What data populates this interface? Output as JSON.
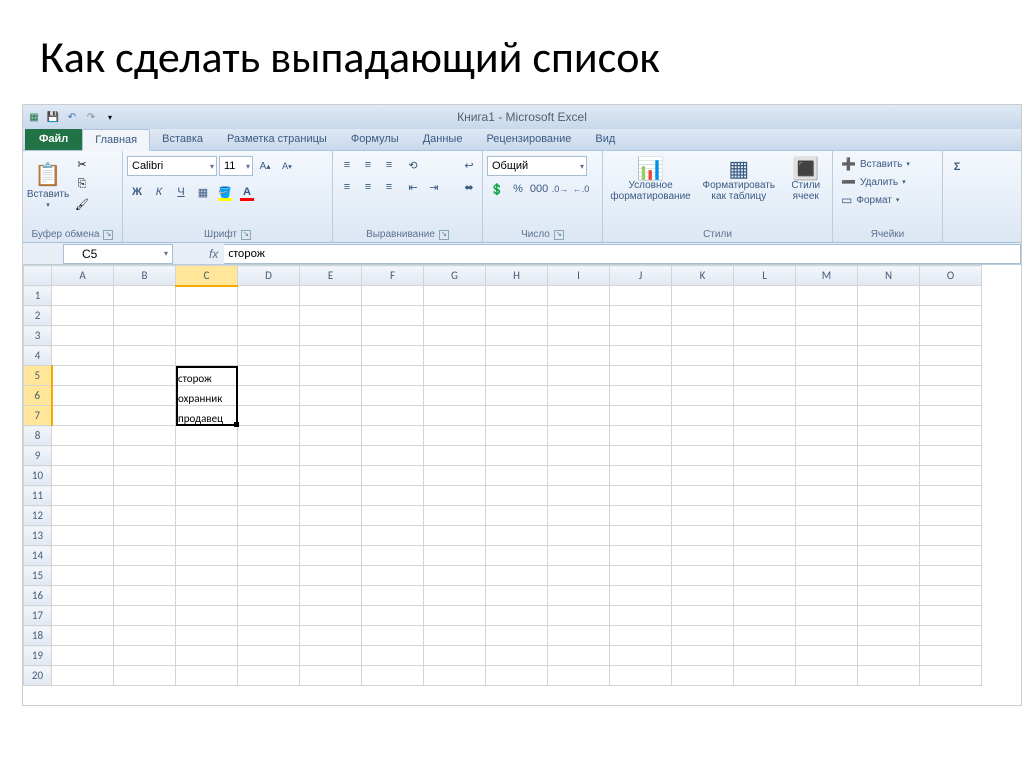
{
  "slide": {
    "title": "Как сделать выпадающий список"
  },
  "titlebar": {
    "text": "Книга1  -  Microsoft Excel"
  },
  "tabs": {
    "file": "Файл",
    "items": [
      "Главная",
      "Вставка",
      "Разметка страницы",
      "Формулы",
      "Данные",
      "Рецензирование",
      "Вид"
    ],
    "active_index": 0
  },
  "ribbon": {
    "clipboard": {
      "paste": "Вставить",
      "label": "Буфер обмена"
    },
    "font": {
      "name": "Calibri",
      "size": "11",
      "bold": "Ж",
      "italic": "К",
      "underline": "Ч",
      "label": "Шрифт"
    },
    "alignment": {
      "label": "Выравнивание"
    },
    "number": {
      "format": "Общий",
      "percent": "%",
      "thousands": "000",
      "label": "Число"
    },
    "styles": {
      "conditional": "Условное\nформатирование",
      "table": "Форматировать\nкак таблицу",
      "cell": "Стили\nячеек",
      "label": "Стили"
    },
    "cells": {
      "insert": "Вставить",
      "delete": "Удалить",
      "format": "Формат",
      "label": "Ячейки"
    }
  },
  "namebox": {
    "value": "C5"
  },
  "formula": {
    "value": "сторож"
  },
  "columns": [
    "A",
    "B",
    "C",
    "D",
    "E",
    "F",
    "G",
    "H",
    "I",
    "J",
    "K",
    "L",
    "M",
    "N",
    "O"
  ],
  "rows": [
    1,
    2,
    3,
    4,
    5,
    6,
    7,
    8,
    9,
    10,
    11,
    12,
    13,
    14,
    15,
    16,
    17,
    18,
    19,
    20
  ],
  "cells": {
    "C5": "сторож",
    "C6": "охранник",
    "C7": "продавец"
  },
  "selection": {
    "col": "C",
    "rows": [
      5,
      6,
      7
    ]
  }
}
